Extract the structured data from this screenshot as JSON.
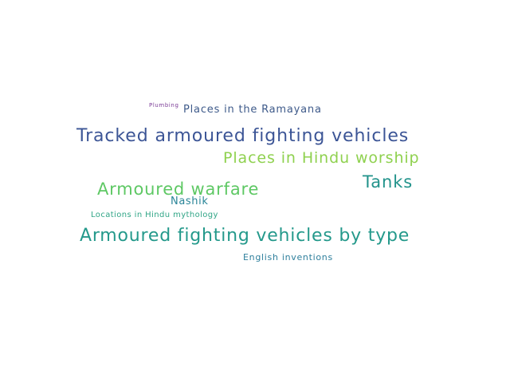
{
  "words": [
    {
      "id": "plumbing",
      "text": "Plumbing",
      "color": "#7a3a95"
    },
    {
      "id": "ramayana",
      "text": "Places in the Ramayana",
      "color": "#3e5a8a"
    },
    {
      "id": "tracked",
      "text": "Tracked armoured fighting vehicles",
      "color": "#3c5596"
    },
    {
      "id": "hindu_worship",
      "text": "Places in Hindu worship",
      "color": "#8fd14f"
    },
    {
      "id": "tanks",
      "text": "Tanks",
      "color": "#22938b"
    },
    {
      "id": "warfare",
      "text": "Armoured warfare",
      "color": "#5ec864"
    },
    {
      "id": "nashik",
      "text": "Nashik",
      "color": "#2a8598"
    },
    {
      "id": "locations",
      "text": "Locations in Hindu mythology",
      "color": "#30a586"
    },
    {
      "id": "afv_type",
      "text": "Armoured fighting vehicles by type",
      "color": "#24998b"
    },
    {
      "id": "english",
      "text": "English inventions",
      "color": "#2e7f9c"
    }
  ]
}
